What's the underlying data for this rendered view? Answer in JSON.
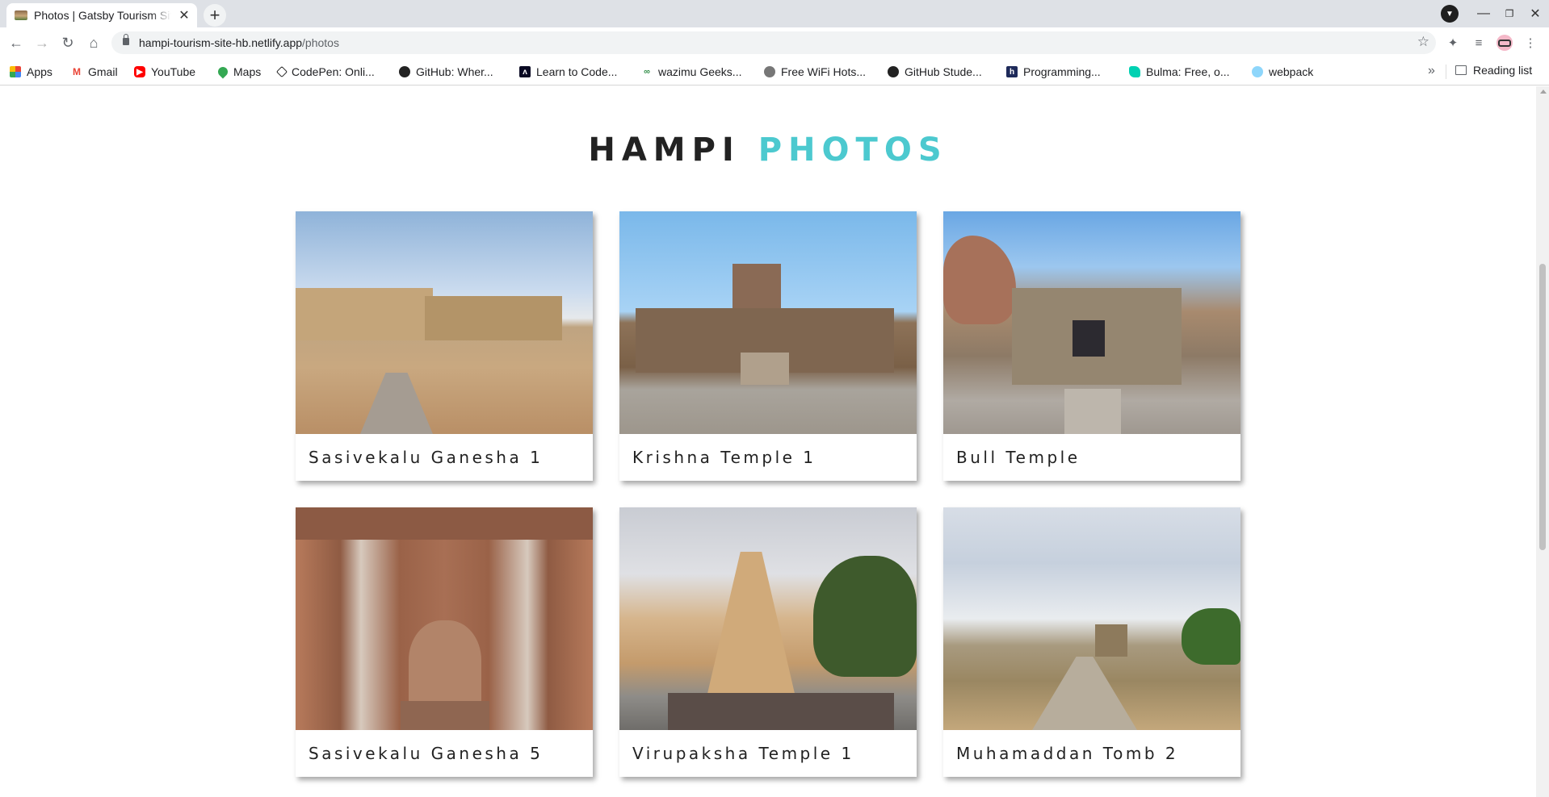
{
  "browser": {
    "tab_title": "Photos | Gatsby Tourism Site",
    "url_host": "hampi-tourism-site-hb.netlify.app",
    "url_path": "/photos",
    "bookmarks": [
      {
        "label": "Apps",
        "icon": "apps-grid-icon"
      },
      {
        "label": "Gmail",
        "icon": "gmail-icon"
      },
      {
        "label": "YouTube",
        "icon": "youtube-icon"
      },
      {
        "label": "Maps",
        "icon": "maps-icon"
      },
      {
        "label": "CodePen: Onli...",
        "icon": "codepen-icon"
      },
      {
        "label": "GitHub: Wher...",
        "icon": "github-icon"
      },
      {
        "label": "Learn to Code...",
        "icon": "freecodecamp-icon"
      },
      {
        "label": "wazimu Geeks...",
        "icon": "wazimu-icon"
      },
      {
        "label": "Free WiFi Hots...",
        "icon": "globe-icon"
      },
      {
        "label": "GitHub Stude...",
        "icon": "github-icon"
      },
      {
        "label": "Programming...",
        "icon": "hashnode-icon"
      },
      {
        "label": "Bulma: Free, o...",
        "icon": "bulma-icon"
      },
      {
        "label": "webpack",
        "icon": "webpack-icon"
      }
    ],
    "reading_list": "Reading list"
  },
  "page": {
    "heading_part1": "HAMPI",
    "heading_part2": "PHOTOS",
    "photos": [
      {
        "title": "Sasivekalu Ganesha 1"
      },
      {
        "title": "Krishna Temple 1"
      },
      {
        "title": "Bull Temple"
      },
      {
        "title": "Sasivekalu Ganesha 5"
      },
      {
        "title": "Virupaksha Temple 1"
      },
      {
        "title": "Muhamaddan Tomb 2"
      }
    ]
  },
  "colors": {
    "accent": "#4cc9cf",
    "heading_dark": "#222222"
  }
}
